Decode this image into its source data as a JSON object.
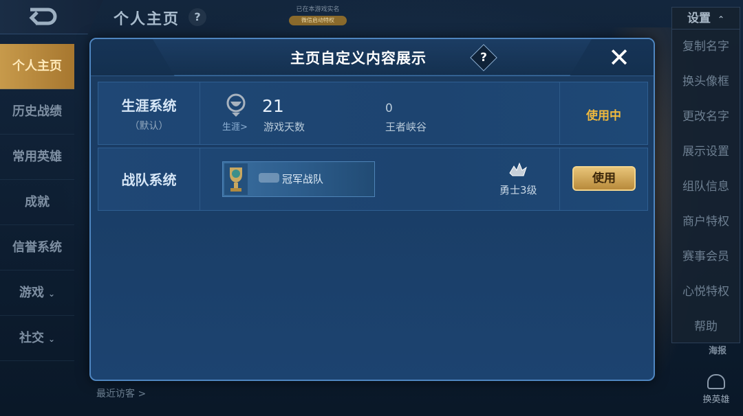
{
  "header": {
    "page_title": "个人主页",
    "help_icon": "question-icon",
    "realname_text": "已在本游戏实名",
    "realname_pill": "微信启动特权"
  },
  "left_nav": {
    "items": [
      {
        "label": "个人主页",
        "active": true
      },
      {
        "label": "历史战绩"
      },
      {
        "label": "常用英雄"
      },
      {
        "label": "成就"
      },
      {
        "label": "信誉系统"
      },
      {
        "label": "游戏",
        "chevron": "⌄"
      },
      {
        "label": "社交",
        "chevron": "⌄"
      }
    ],
    "recent_visitors": "最近访客 >"
  },
  "right_menu": {
    "settings_label": "设置",
    "caret": "⌃",
    "items": [
      "复制名字",
      "换头像框",
      "更改名字",
      "展示设置",
      "组队信息",
      "商户特权",
      "赛事会员",
      "心悦特权",
      "帮助"
    ],
    "poster_label": "海报",
    "switch_hero_label": "换英雄"
  },
  "modal": {
    "title": "主页自定义内容展示",
    "help": "?",
    "close": "✕",
    "career": {
      "label": "生涯系统",
      "sub_label": "（默认）",
      "link": "生涯>",
      "days_value": "21",
      "days_label": "游戏天数",
      "canyon_value": "0",
      "canyon_label": "王者峡谷",
      "status": "使用中"
    },
    "team": {
      "label": "战队系统",
      "team_name": "冠军战队",
      "rank_label": "勇士3级",
      "use_button": "使用"
    }
  },
  "colors": {
    "accent_gold": "#f0b93d",
    "active_nav": "#c79a4b",
    "modal_border": "#4f86c0"
  }
}
